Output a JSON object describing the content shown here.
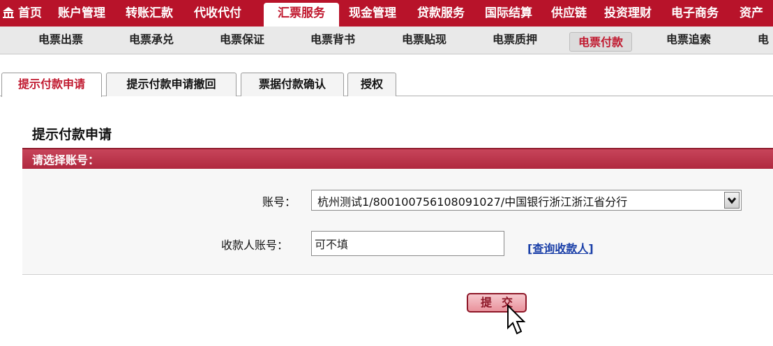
{
  "topnav": {
    "home_icon": "bank-home-icon",
    "items": [
      "首页",
      "账户管理",
      "转账汇款",
      "代收代付",
      "汇票服务",
      "现金管理",
      "贷款服务",
      "国际结算",
      "供应链",
      "投资理财",
      "电子商务",
      "资产"
    ],
    "active": "汇票服务"
  },
  "subnav": {
    "items": [
      "电票出票",
      "电票承兑",
      "电票保证",
      "电票背书",
      "电票贴现",
      "电票质押",
      "电票付款",
      "电票追索",
      "电"
    ],
    "active": "电票付款"
  },
  "tabs": [
    "提示付款申请",
    "提示付款申请撤回",
    "票据付款确认",
    "授权"
  ],
  "form": {
    "title": "提示付款申请",
    "section_header": "请选择账号：",
    "account_label": "账号：",
    "account_value": "杭州测试1/800100756108091027/中国银行浙江浙江省分行",
    "payee_label": "收款人账号：",
    "payee_value": "可不填",
    "query_link": "[查询收款人]",
    "submit_label": "提交"
  },
  "colors": {
    "brand_red": "#b8132a",
    "link_blue": "#1a3fa8"
  }
}
